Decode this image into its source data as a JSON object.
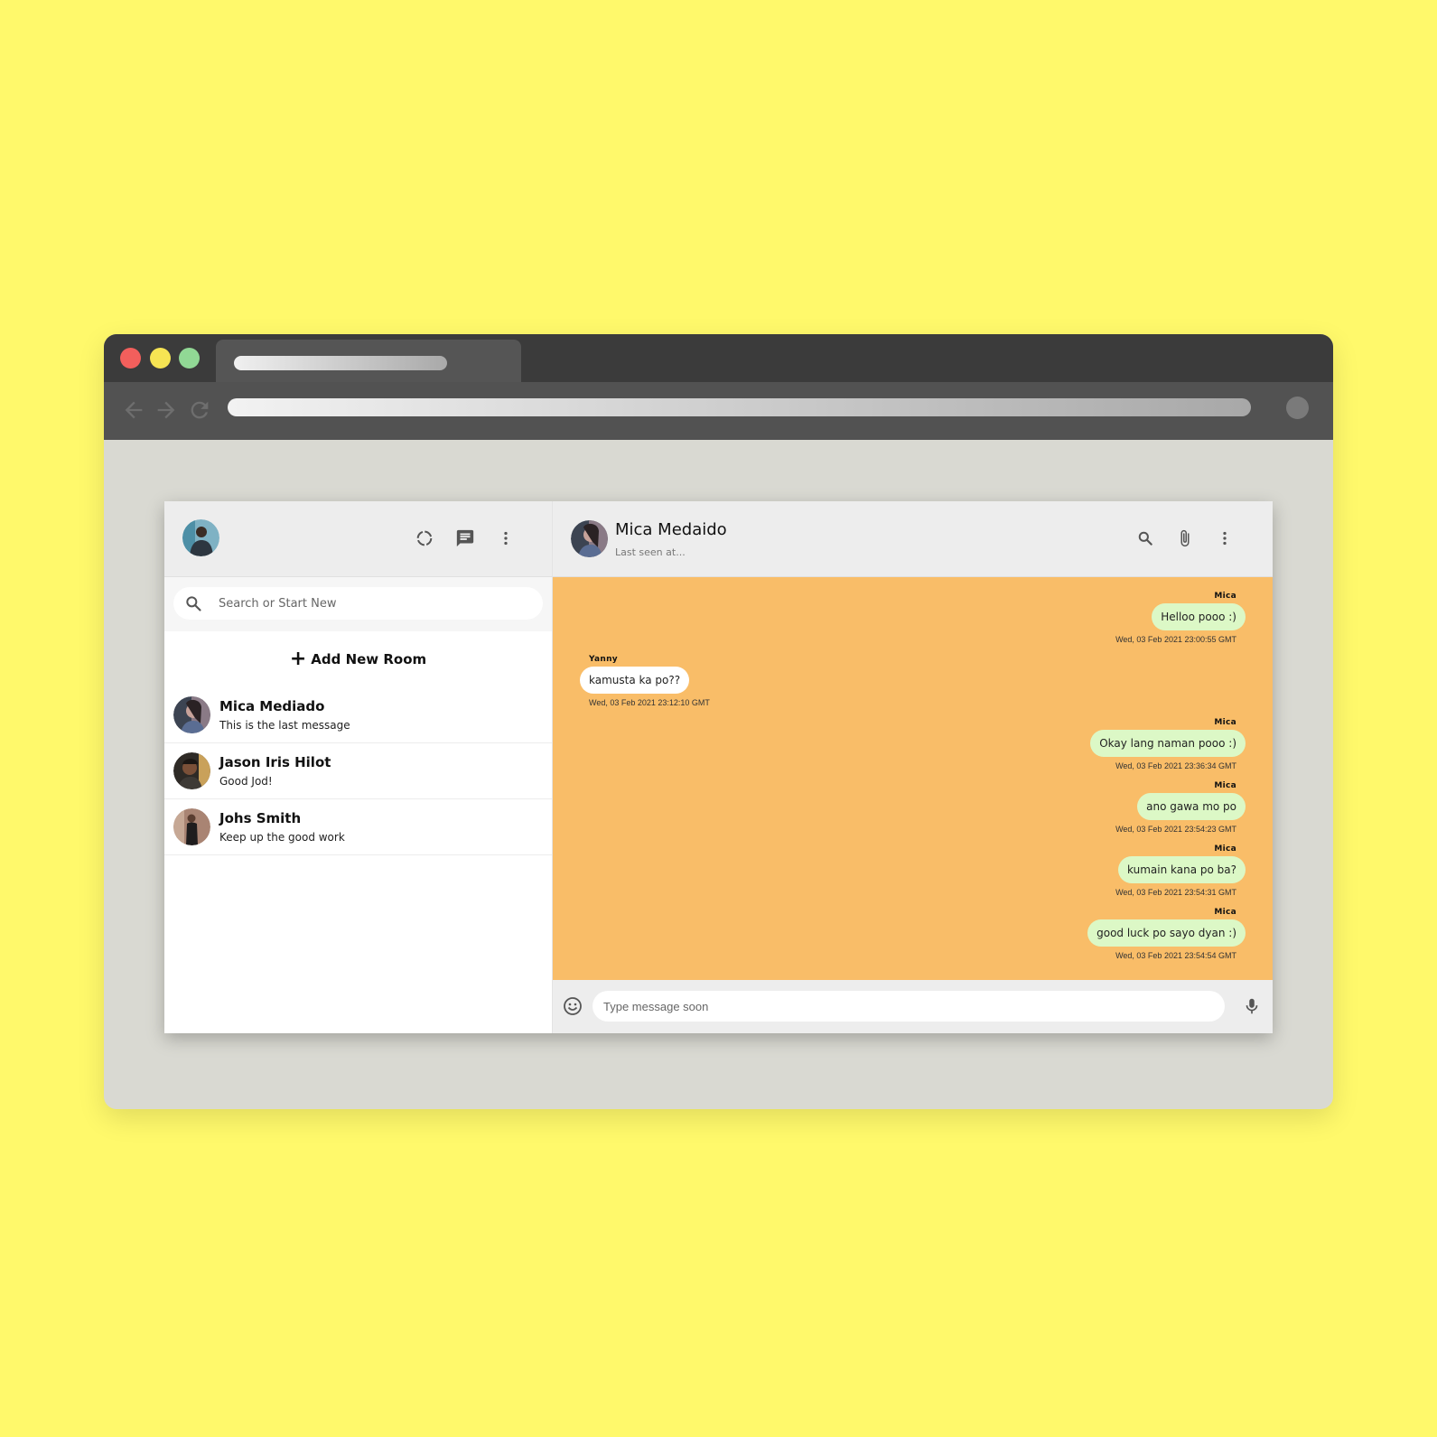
{
  "browser": {
    "colors": {
      "background": "#fff96b",
      "titlebar": "#3b3b3b",
      "toolbar": "#525252"
    }
  },
  "sidebar": {
    "header_icons": [
      "status-icon",
      "new-chat-icon",
      "more-vert-icon"
    ],
    "search_placeholder": "Search or Start New",
    "add_room_label": "Add New Room",
    "chats": [
      {
        "name": "Mica Mediado",
        "last_message": "This is the last message"
      },
      {
        "name": "Jason Iris Hilot",
        "last_message": "Good Jod!"
      },
      {
        "name": "Johs Smith",
        "last_message": "Keep up the good work"
      }
    ]
  },
  "main": {
    "contact_name": "Mica Medaido",
    "last_seen": "Last seen at...",
    "header_icons": [
      "search-icon",
      "attach-icon",
      "more-vert-icon"
    ],
    "messages": [
      {
        "direction": "sent",
        "sender": "Mica",
        "text": "Helloo pooo :)",
        "time": "Wed, 03 Feb 2021 23:00:55 GMT"
      },
      {
        "direction": "recv",
        "sender": "Yanny",
        "text": "kamusta ka po??",
        "time": "Wed, 03 Feb 2021 23:12:10 GMT"
      },
      {
        "direction": "sent",
        "sender": "Mica",
        "text": "Okay lang naman pooo :)",
        "time": "Wed, 03 Feb 2021 23:36:34 GMT"
      },
      {
        "direction": "sent",
        "sender": "Mica",
        "text": "ano gawa mo po",
        "time": "Wed, 03 Feb 2021 23:54:23 GMT"
      },
      {
        "direction": "sent",
        "sender": "Mica",
        "text": "kumain kana po ba?",
        "time": "Wed, 03 Feb 2021 23:54:31 GMT"
      },
      {
        "direction": "sent",
        "sender": "Mica",
        "text": "good luck po sayo dyan :)",
        "time": "Wed, 03 Feb 2021 23:54:54 GMT"
      }
    ],
    "composer_placeholder": "Type message soon",
    "colors": {
      "chat_background": "#f9bd68",
      "sent_bubble": "#dcf8c6",
      "received_bubble": "#ffffff"
    }
  }
}
